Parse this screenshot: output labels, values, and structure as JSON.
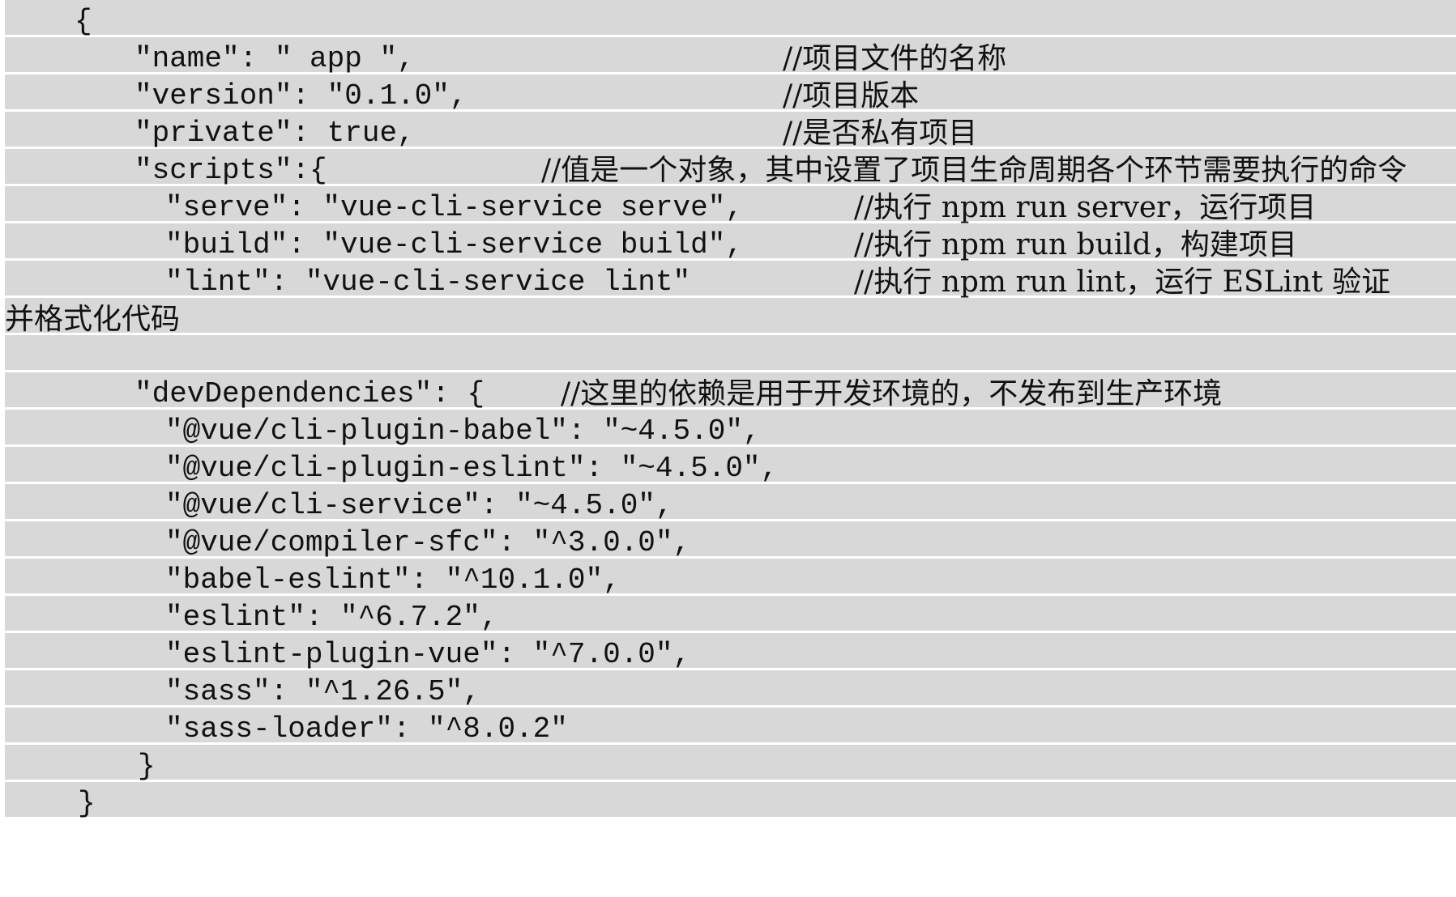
{
  "lines": [
    {
      "code": "{",
      "comment": ""
    },
    {
      "code": "\"name\": \" app \",",
      "comment": "//项目文件的名称"
    },
    {
      "code": "\"version\": \"0.1.0\",",
      "comment": "//项目版本"
    },
    {
      "code": "\"private\": true,",
      "comment": "//是否私有项目"
    },
    {
      "code": "\"scripts\":{",
      "comment": "//值是一个对象，其中设置了项目生命周期各个环节需要执行的命令"
    },
    {
      "code": "\"serve\": \"vue-cli-service serve\",",
      "comment": "//执行 npm run server，运行项目"
    },
    {
      "code": "\"build\": \"vue-cli-service build\",",
      "comment": "//执行 npm run build，构建项目"
    },
    {
      "code": "\"lint\": \"vue-cli-service lint\"",
      "comment": "//执行 npm run lint，运行 ESLint 验证"
    },
    {
      "code": "",
      "comment": "并格式化代码"
    },
    {
      "code": "",
      "comment": ""
    },
    {
      "code": "\"devDependencies\": {",
      "comment": "//这里的依赖是用于开发环境的，不发布到生产环境"
    },
    {
      "code": "\"@vue/cli-plugin-babel\": \"~4.5.0\",",
      "comment": ""
    },
    {
      "code": "\"@vue/cli-plugin-eslint\": \"~4.5.0\",",
      "comment": ""
    },
    {
      "code": "\"@vue/cli-service\": \"~4.5.0\",",
      "comment": ""
    },
    {
      "code": "\"@vue/compiler-sfc\": \"^3.0.0\",",
      "comment": ""
    },
    {
      "code": "\"babel-eslint\": \"^10.1.0\",",
      "comment": ""
    },
    {
      "code": "\"eslint\": \"^6.7.2\",",
      "comment": ""
    },
    {
      "code": "\"eslint-plugin-vue\": \"^7.0.0\",",
      "comment": ""
    },
    {
      "code": "\"sass\": \"^1.26.5\",",
      "comment": ""
    },
    {
      "code": "\"sass-loader\": \"^8.0.2\"",
      "comment": ""
    },
    {
      "code": "}",
      "comment": ""
    },
    {
      "code": "}",
      "comment": ""
    }
  ]
}
